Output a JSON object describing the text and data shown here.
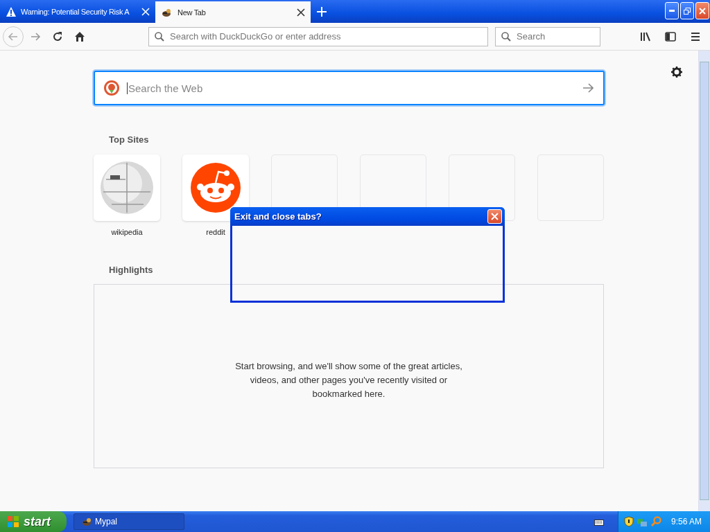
{
  "tabs": [
    {
      "title": "Warning: Potential Security Risk A",
      "kind": "warning",
      "selected": false
    },
    {
      "title": "New Tab",
      "kind": "mascot",
      "selected": true
    }
  ],
  "toolbar": {
    "address_placeholder": "Search with DuckDuckGo or enter address",
    "search_placeholder": "Search"
  },
  "page": {
    "search_placeholder": "Search the Web",
    "top_sites": {
      "heading": "Top Sites",
      "sites": [
        {
          "kind": "wikipedia",
          "label": "wikipedia"
        },
        {
          "kind": "reddit",
          "label": "reddit"
        },
        {
          "kind": "empty"
        },
        {
          "kind": "empty"
        },
        {
          "kind": "empty"
        },
        {
          "kind": "empty"
        }
      ]
    },
    "highlights": {
      "heading": "Highlights",
      "message": "Start browsing, and we'll show some of the great articles, videos, and other pages you've recently visited or bookmarked here."
    }
  },
  "dialog": {
    "title": "Exit and close tabs?"
  },
  "taskbar": {
    "start": "start",
    "tasks": [
      {
        "label": "Mypal"
      }
    ],
    "clock": "9:56 AM"
  }
}
